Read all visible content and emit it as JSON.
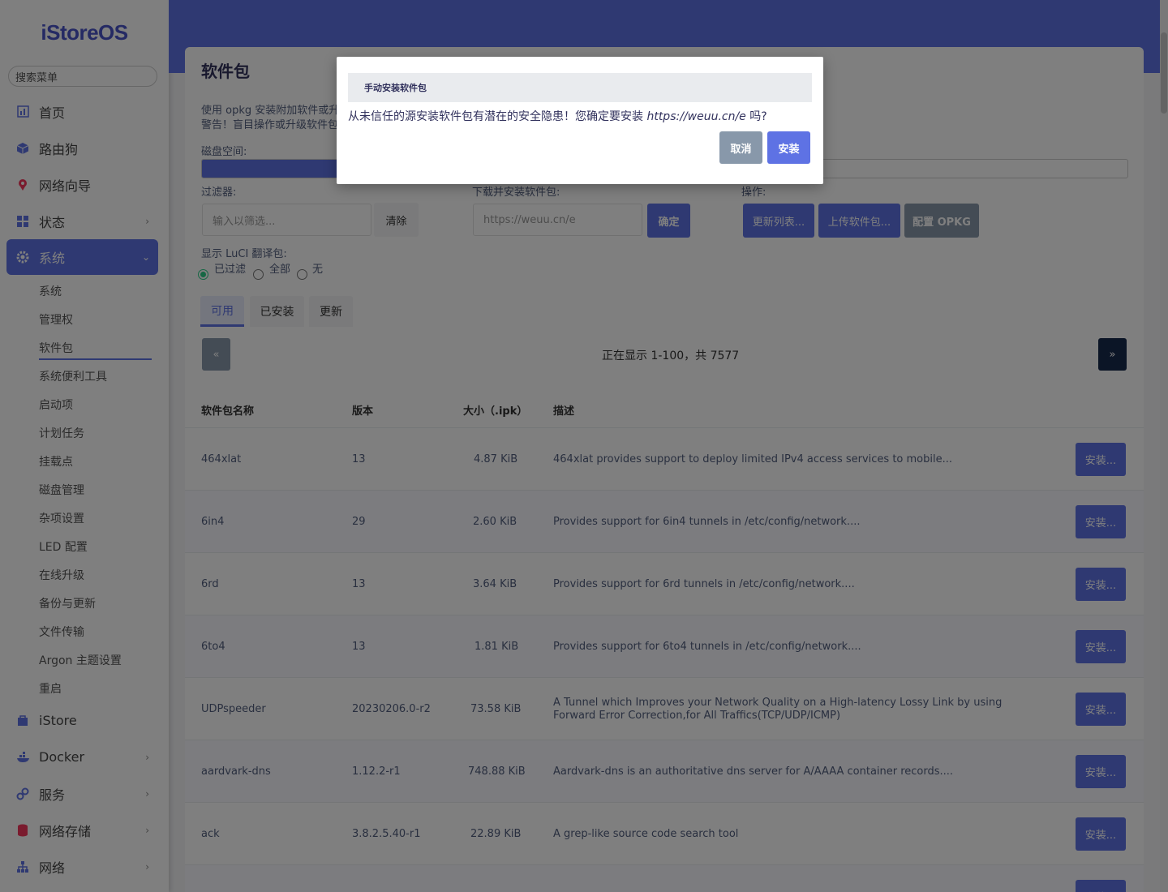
{
  "brand": {
    "logo": "iStoreOS"
  },
  "sidebar": {
    "search_placeholder": "搜索菜单",
    "items": [
      {
        "label": "首页"
      },
      {
        "label": "路由狗"
      },
      {
        "label": "网络向导"
      },
      {
        "label": "状态"
      },
      {
        "label": "系统"
      }
    ],
    "system_sub": [
      "系统",
      "管理权",
      "软件包",
      "系统便利工具",
      "启动项",
      "计划任务",
      "挂载点",
      "磁盘管理",
      "杂项设置",
      "LED 配置",
      "在线升级",
      "备份与更新",
      "文件传输",
      "Argon 主题设置",
      "重启"
    ],
    "bottom_items": [
      {
        "label": "iStore"
      },
      {
        "label": "Docker"
      },
      {
        "label": "服务"
      },
      {
        "label": "网络存储"
      },
      {
        "label": "网络"
      }
    ]
  },
  "page": {
    "title": "软件包",
    "desc_line1": "使用 opkg 安装附加软件或升",
    "desc_line2": "警告！盲目操作或升级软件包",
    "disk_label": "磁盘空间:",
    "filter_label": "过滤器:",
    "filter_placeholder": "输入以筛选...",
    "clear_label": "清除",
    "download_label": "下载并安装软件包:",
    "download_value": "https://weuu.cn/e",
    "confirm_label": "确定",
    "actions_label": "操作:",
    "update_list": "更新列表...",
    "upload_pkg": "上传软件包...",
    "config_opkg": "配置 OPKG",
    "luci_label": "显示 LuCI 翻译包:",
    "radio_filtered": "已过滤",
    "radio_all": "全部",
    "radio_none": "无",
    "tabs": [
      "可用",
      "已安装",
      "更新"
    ],
    "prev": "«",
    "next": "»",
    "pager_info": "正在显示 1-100，共 7577"
  },
  "table": {
    "headers": [
      "软件包名称",
      "版本",
      "大小（.ipk）",
      "描述"
    ],
    "install_label": "安装...",
    "rows": [
      {
        "name": "464xlat",
        "version": "13",
        "size": "4.87 KiB",
        "desc": "464xlat provides support to deploy limited IPv4 access services to mobile..."
      },
      {
        "name": "6in4",
        "version": "29",
        "size": "2.60 KiB",
        "desc": "Provides support for 6in4 tunnels in /etc/config/network...."
      },
      {
        "name": "6rd",
        "version": "13",
        "size": "3.64 KiB",
        "desc": "Provides support for 6rd tunnels in /etc/config/network...."
      },
      {
        "name": "6to4",
        "version": "13",
        "size": "1.81 KiB",
        "desc": "Provides support for 6to4 tunnels in /etc/config/network...."
      },
      {
        "name": "UDPspeeder",
        "version": "20230206.0-r2",
        "size": "73.58 KiB",
        "desc": "A Tunnel which Improves your Network Quality on a High-latency Lossy Link by using Forward Error Correction,for All Traffics(TCP/UDP/ICMP)"
      },
      {
        "name": "aardvark-dns",
        "version": "1.12.2-r1",
        "size": "748.88 KiB",
        "desc": "Aardvark-dns is an authoritative dns server for A/AAAA container records...."
      },
      {
        "name": "ack",
        "version": "3.8.2.5.40-r1",
        "size": "22.89 KiB",
        "desc": "A grep-like source code search tool"
      }
    ]
  },
  "modal": {
    "title": "手动安装软件包",
    "message_prefix": "从未信任的源安装软件包有潜在的安全隐患！您确定要安装 ",
    "message_url": "https://weuu.cn/e",
    "message_suffix": " 吗?",
    "cancel": "取消",
    "install": "安装"
  },
  "colors": {
    "accent": "#5e72e4",
    "topbar": "#5e72e4"
  }
}
